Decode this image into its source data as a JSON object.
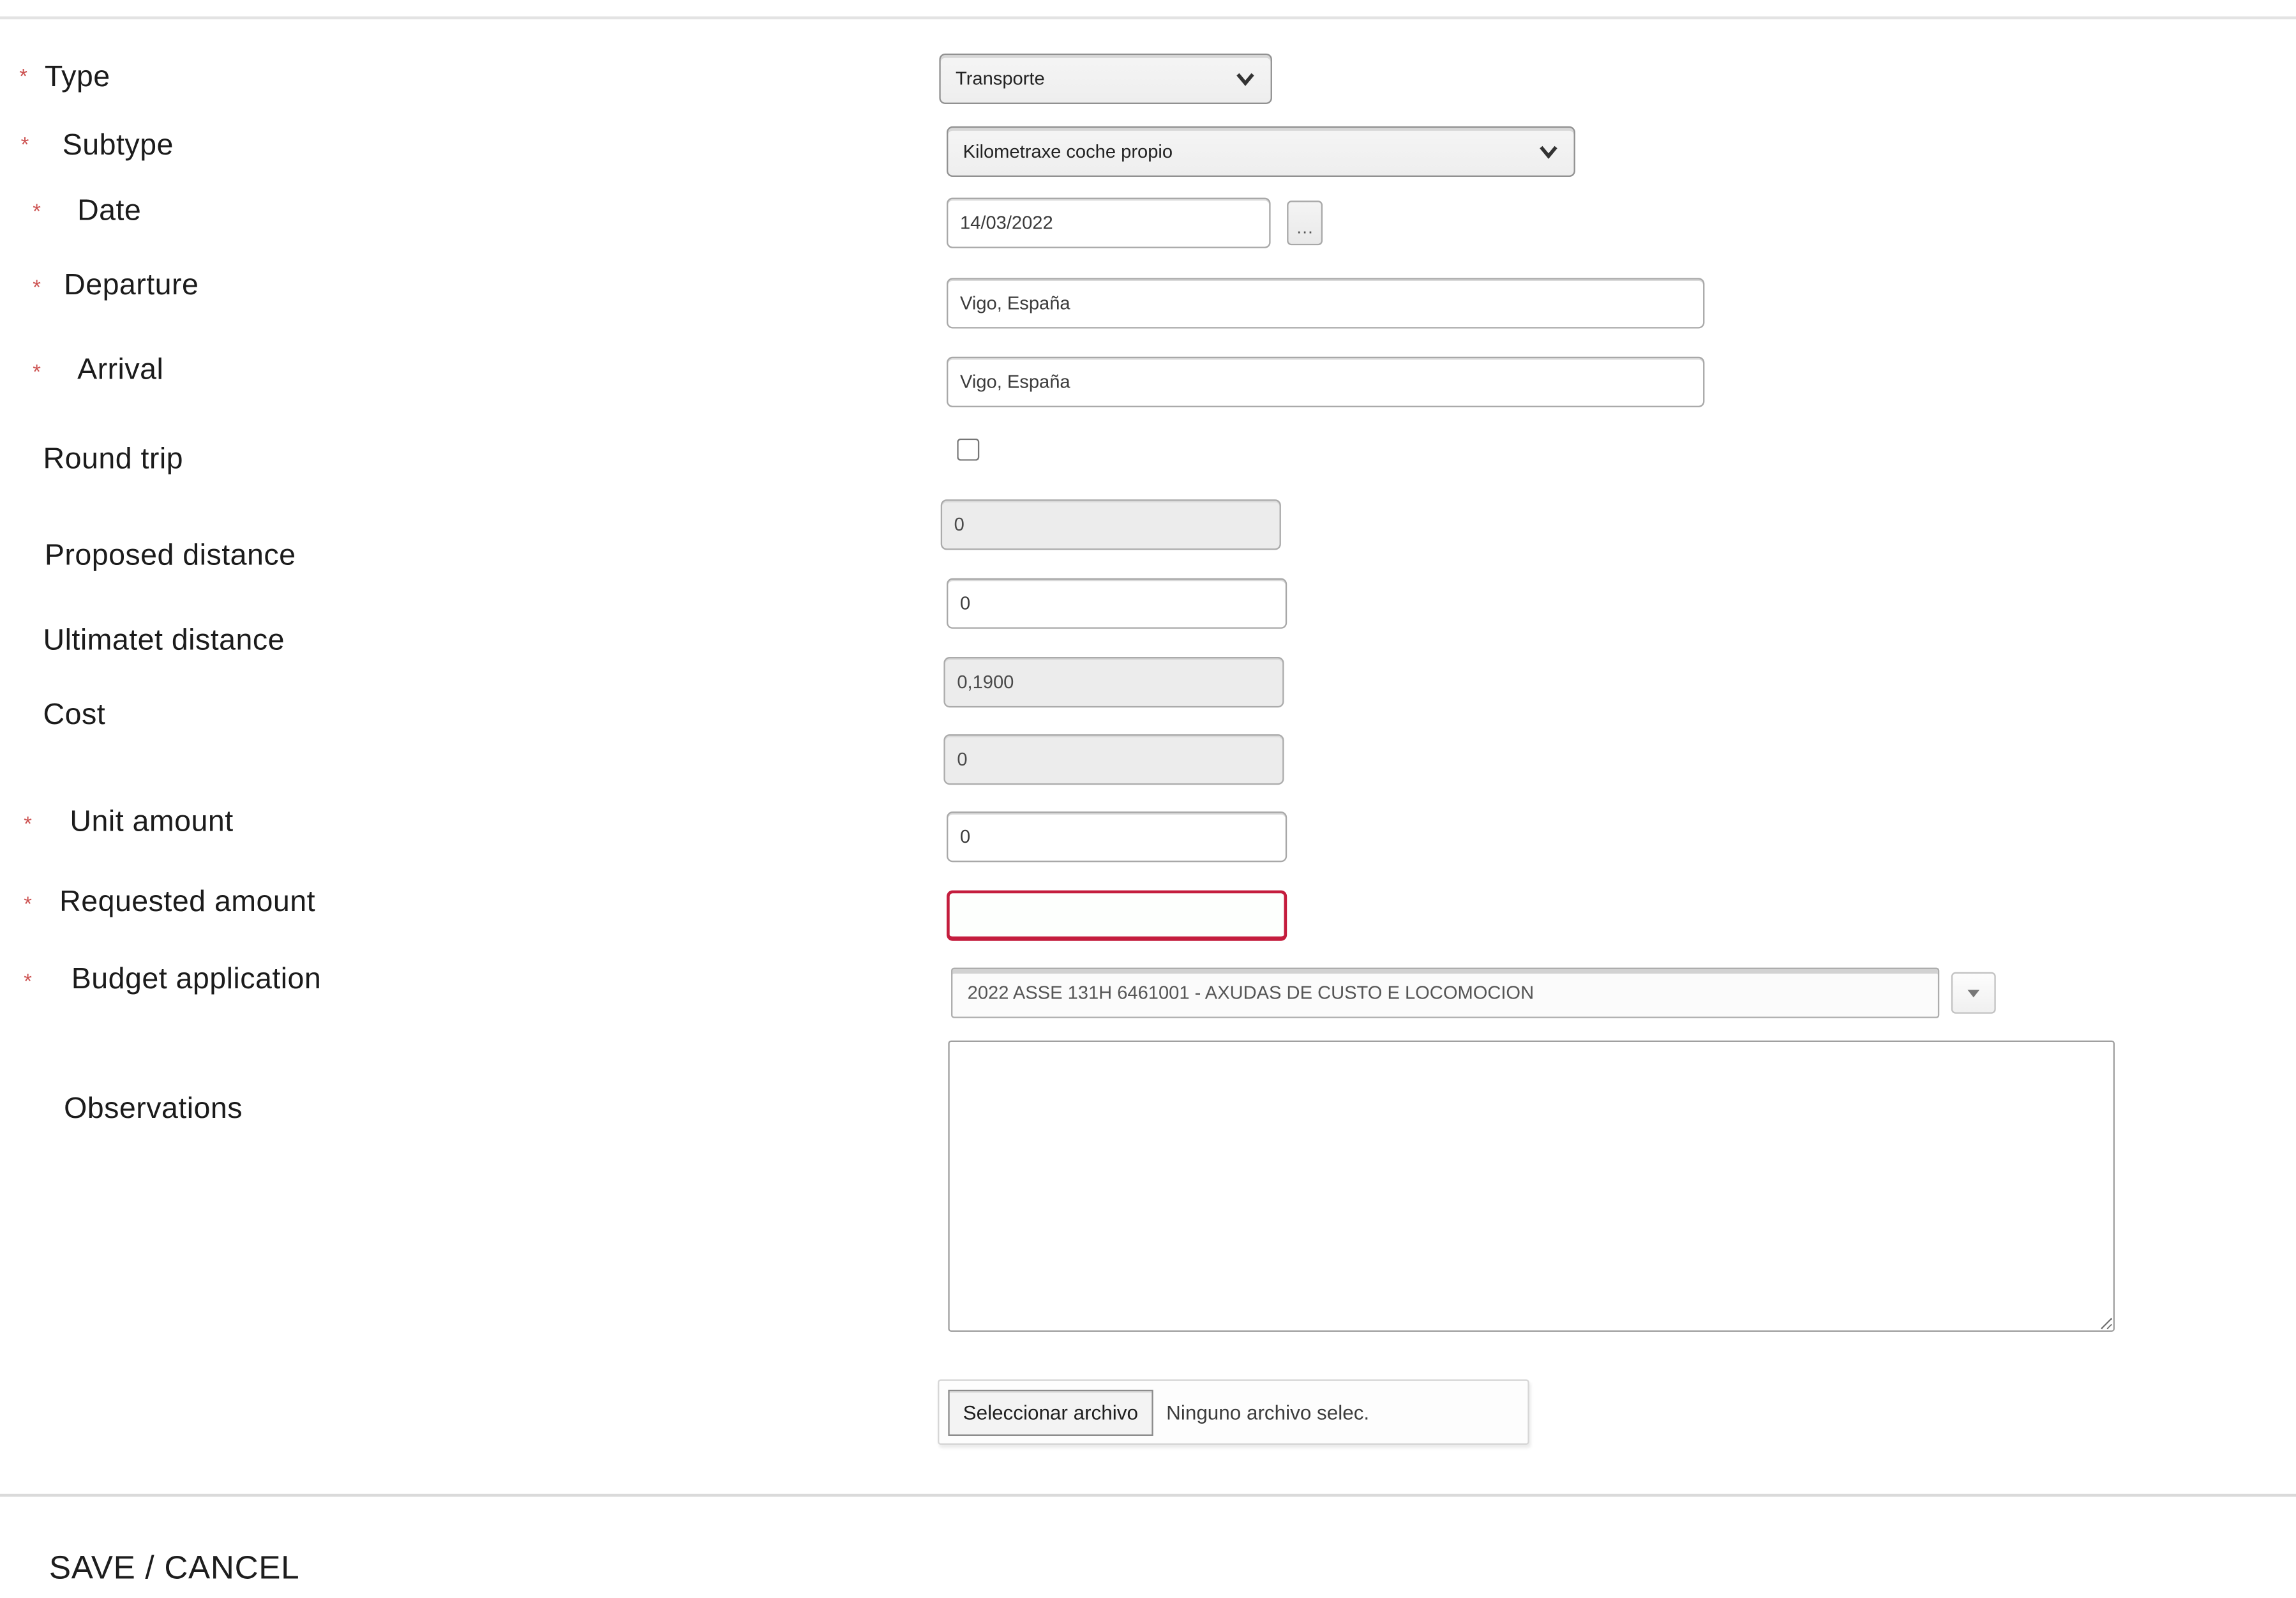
{
  "misc": {
    "required_marker": "*",
    "date_button_label": "…"
  },
  "form": {
    "type": {
      "label": "Type",
      "required": true,
      "value": "Transporte"
    },
    "subtype": {
      "label": "Subtype",
      "required": true,
      "value": "Kilometraxe coche propio"
    },
    "date": {
      "label": "Date",
      "required": true,
      "value": "14/03/2022"
    },
    "departure": {
      "label": "Departure",
      "required": true,
      "value": "Vigo, España"
    },
    "arrival": {
      "label": "Arrival",
      "required": true,
      "value": "Vigo, España"
    },
    "round_trip": {
      "label": "Round trip",
      "checked": false
    },
    "proposed_distance": {
      "label": "Proposed distance",
      "value": "0",
      "disabled": true
    },
    "ultimate_distance": {
      "label": "Ultimatet distance",
      "value": "0"
    },
    "cost": {
      "label": "Cost",
      "rate_value": "0,1900",
      "total_value": "0",
      "disabled": true
    },
    "unit_amount": {
      "label": "Unit amount",
      "required": true,
      "value": "0"
    },
    "requested_amount": {
      "label": "Requested amount",
      "required": true,
      "value": ""
    },
    "budget_application": {
      "label": "Budget application",
      "required": true,
      "value": "2022 ASSE 131H 6461001 - AXUDAS DE CUSTO E LOCOMOCION"
    },
    "observations": {
      "label": "Observations",
      "value": ""
    },
    "attachment": {
      "button_label": "Seleccionar archivo",
      "status_text": "Ninguno archivo selec."
    }
  },
  "footer": {
    "save_label": "SAVE",
    "separator": "/",
    "cancel_label": "CANCEL"
  },
  "colors": {
    "asterisk": "#cc5150",
    "error_border": "#c41d3d",
    "divider": "#e3e3e3"
  }
}
